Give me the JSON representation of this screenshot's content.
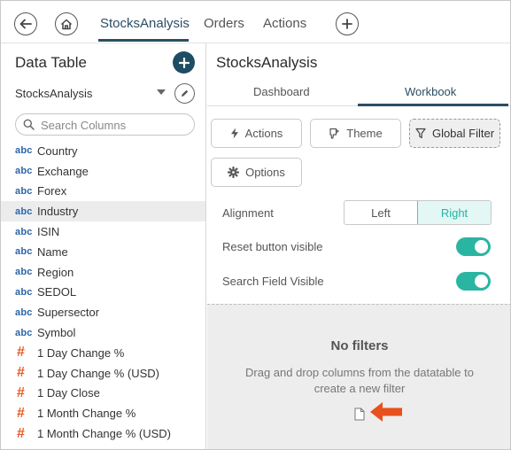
{
  "top_nav": {
    "tabs": [
      {
        "label": "StocksAnalysis",
        "active": true
      },
      {
        "label": "Orders",
        "active": false
      },
      {
        "label": "Actions",
        "active": false
      }
    ],
    "icons": [
      "back-arrow-icon",
      "home-icon",
      "plus-icon"
    ]
  },
  "left_panel": {
    "title": "Data Table",
    "data_source": "StocksAnalysis",
    "search_placeholder": "Search Columns",
    "columns": [
      {
        "type": "abc",
        "name": "Country"
      },
      {
        "type": "abc",
        "name": "Exchange"
      },
      {
        "type": "abc",
        "name": "Forex"
      },
      {
        "type": "abc",
        "name": "Industry",
        "highlighted": true
      },
      {
        "type": "abc",
        "name": "ISIN"
      },
      {
        "type": "abc",
        "name": "Name"
      },
      {
        "type": "abc",
        "name": "Region"
      },
      {
        "type": "abc",
        "name": "SEDOL"
      },
      {
        "type": "abc",
        "name": "Supersector"
      },
      {
        "type": "abc",
        "name": "Symbol"
      },
      {
        "type": "#",
        "name": "1 Day Change %"
      },
      {
        "type": "#",
        "name": "1 Day Change % (USD)"
      },
      {
        "type": "#",
        "name": "1 Day Close"
      },
      {
        "type": "#",
        "name": "1 Month Change %"
      },
      {
        "type": "#",
        "name": "1 Month Change % (USD)"
      }
    ]
  },
  "right_panel": {
    "title": "StocksAnalysis",
    "tabs": [
      {
        "label": "Dashboard",
        "active": false
      },
      {
        "label": "Workbook",
        "active": true
      }
    ],
    "buttons": {
      "actions": "Actions",
      "theme": "Theme",
      "global_filter": "Global Filter",
      "options": "Options"
    },
    "alignment": {
      "label": "Alignment",
      "options": [
        "Left",
        "Right"
      ],
      "selected": "Right"
    },
    "reset_button_visible": {
      "label": "Reset button visible",
      "on": true
    },
    "search_field_visible": {
      "label": "Search Field Visible",
      "on": true
    },
    "drop_zone": {
      "title": "No filters",
      "hint": "Drag and drop columns from the datatable to create a new filter"
    }
  },
  "colors": {
    "brand_dark": "#1e4c63",
    "accent_teal": "#2ab5a3",
    "numeric_type": "#e65a1f",
    "text_type": "#2b64a8",
    "annotation_arrow": "#e8501c"
  }
}
